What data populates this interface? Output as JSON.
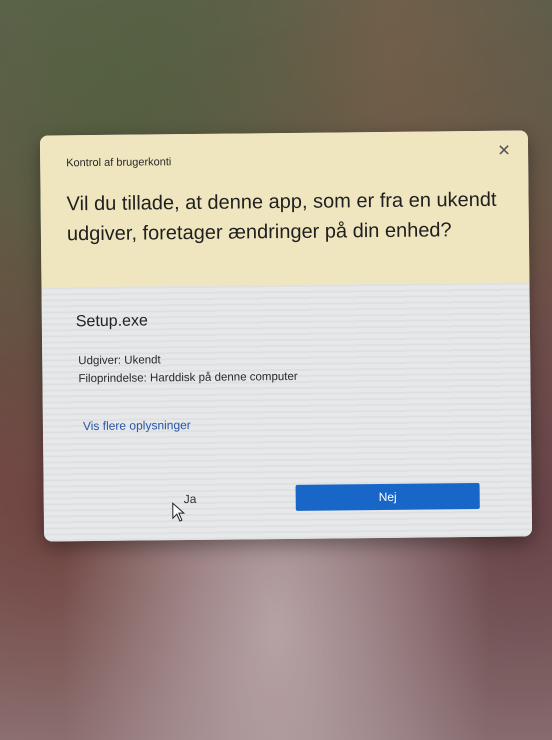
{
  "dialog": {
    "title": "Kontrol af brugerkonti",
    "close_glyph": "✕",
    "question": "Vil du tillade, at denne app, som er fra en ukendt udgiver, foretager ændringer på din enhed?",
    "app_name": "Setup.exe",
    "publisher": "Udgiver: Ukendt",
    "file_origin": "Filoprindelse: Harddisk på denne computer",
    "more_info_link": "Vis flere oplysninger",
    "yes_label": "Ja",
    "no_label": "Nej"
  },
  "colors": {
    "header_background": "#efe6bf",
    "body_background": "#e6e8ea",
    "accent_button": "#1766c8",
    "link": "#2a57a8"
  },
  "icons": {
    "close": "close-icon",
    "pointer": "mouse-pointer-icon"
  }
}
